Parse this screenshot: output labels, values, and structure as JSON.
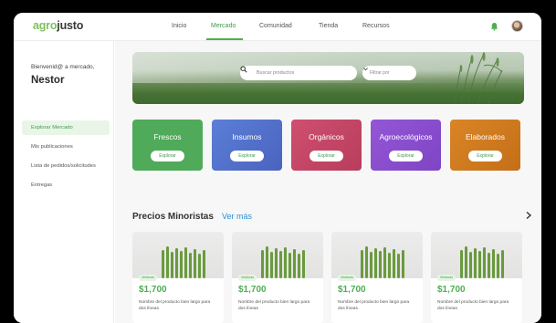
{
  "app": {
    "logo_part1": "agro",
    "logo_part2": "justo"
  },
  "nav": {
    "items": [
      {
        "label": "Inicio",
        "active": false
      },
      {
        "label": "Mercado",
        "active": true
      },
      {
        "label": "Comunidad",
        "active": false
      },
      {
        "label": "Tienda",
        "active": false
      },
      {
        "label": "Recursos",
        "active": false
      }
    ],
    "icons": [
      "bell-icon",
      "avatar"
    ]
  },
  "sidebar": {
    "welcome": "Bienvenid@ a mercado,",
    "username": "Nestor",
    "items": [
      {
        "label": "Explorar Mercado",
        "active": true
      },
      {
        "label": "Mis publicaciones",
        "active": false
      },
      {
        "label": "Lista de pedidos/solicitudes",
        "active": false
      },
      {
        "label": "Entregas",
        "active": false
      }
    ]
  },
  "hero": {
    "search_placeholder": "Buscar productos",
    "filter_label": "Filtrar por"
  },
  "categories": [
    {
      "title": "Frescos",
      "button": "Explorar",
      "color": "#4faa59"
    },
    {
      "title": "Insumos",
      "button": "Explorar",
      "color": "#4f6fc9"
    },
    {
      "title": "Orgánicos",
      "button": "Explorar",
      "color": "#c54767"
    },
    {
      "title": "Agroecológicos",
      "button": "Explorar",
      "color": "#8b4fcf"
    },
    {
      "title": "Elaborados",
      "button": "Explorar",
      "color": "#cf7a1f"
    }
  ],
  "prices_section": {
    "title": "Precios Minoristas",
    "see_more": "Ver más"
  },
  "products": [
    {
      "tag": "Verduras",
      "price": "$1,700",
      "description": "Nombre del producto bien largo para dos líneas"
    },
    {
      "tag": "Verduras",
      "price": "$1,700",
      "description": "Nombre del producto bien largo para dos líneas"
    },
    {
      "tag": "Verduras",
      "price": "$1,700",
      "description": "Nombre del producto bien largo para dos líneas"
    },
    {
      "tag": "Verduras",
      "price": "$1,700",
      "description": "Nombre del producto bien largo para dos líneas"
    }
  ],
  "colors": {
    "brand_green": "#4caf50",
    "link_blue": "#2f8fd0"
  }
}
